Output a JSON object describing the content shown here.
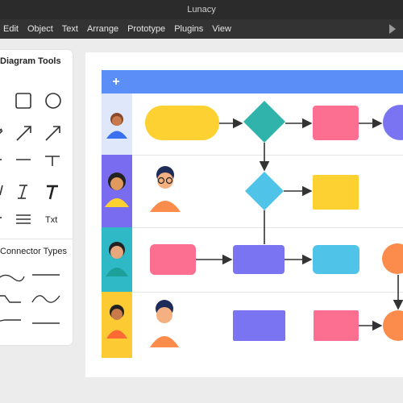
{
  "window": {
    "title": "Lunacy"
  },
  "menu": {
    "items": [
      "Edit",
      "Object",
      "Text",
      "Arrange",
      "Prototype",
      "Plugins",
      "View"
    ]
  },
  "left_panel": {
    "title": "Diagram Tools",
    "text_tool_label": "Txt",
    "connector_title": "Connector Types"
  },
  "canvas": {
    "header_button": "+",
    "colors": {
      "header": "#5b8ff7",
      "yellow": "#fcd131",
      "teal": "#2fb3ab",
      "pink": "#fd6f91",
      "purple": "#7b74f2",
      "sky": "#4fc3e8",
      "orange": "#fb8c4c"
    },
    "lanes": [
      {
        "name": "lane-1",
        "strip_color": "#dfe8fb"
      },
      {
        "name": "lane-2",
        "strip_color": "#7a6cf0"
      },
      {
        "name": "lane-3",
        "strip_color": "#2fb9c6"
      },
      {
        "name": "lane-4",
        "strip_color": "#fcca33"
      }
    ]
  }
}
